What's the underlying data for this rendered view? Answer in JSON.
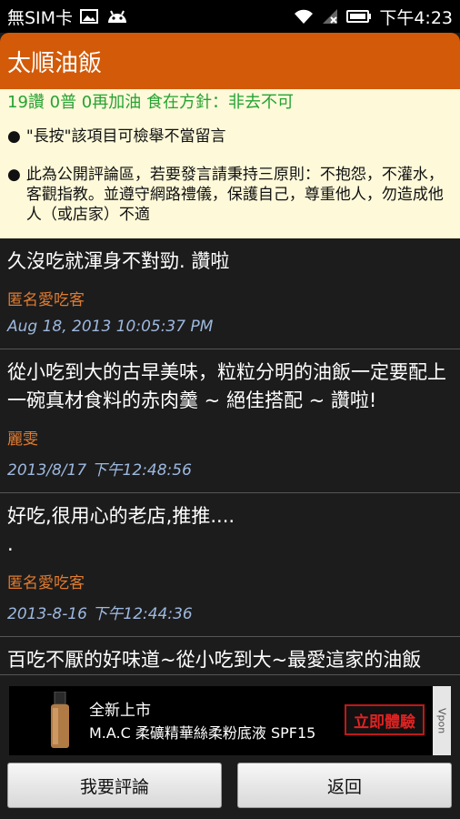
{
  "status_bar": {
    "carrier": "無SIM卡",
    "time": "下午4:23",
    "icons": [
      "image-icon",
      "android-icon",
      "wifi-icon",
      "no-signal-icon",
      "battery-icon"
    ]
  },
  "header": {
    "title": "太順油飯"
  },
  "info": {
    "stats": "19讚 0普 0再加油  食在方針：非去不可",
    "rules": [
      "\"長按\"該項目可檢舉不當留言",
      "此為公開評論區，若要發言請秉持三原則：不抱怨，不灌水，客觀指教。並遵守網路禮儀，保護自己，尊重他人，勿造成他人（或店家）不適"
    ],
    "bullet": "●"
  },
  "comments": [
    {
      "text": "久沒吃就渾身不對勁. 讚啦",
      "author": "匿名愛吃客",
      "time": "Aug 18, 2013 10:05:37 PM"
    },
    {
      "text": "從小吃到大的古早美味，粒粒分明的油飯一定要配上一碗真材食料的赤肉羹 ~ 絕佳搭配 ~ 讚啦!",
      "author": "麗雯",
      "time": "2013/8/17 下午12:48:56"
    },
    {
      "text": "好吃,很用心的老店,推推....\n.",
      "author": "匿名愛吃客",
      "time": "2013-8-16 下午12:44:36"
    },
    {
      "text": "百吃不厭的好味道~從小吃到大~最愛這家的油飯",
      "author": "",
      "time": ""
    }
  ],
  "ad": {
    "line1": "全新上市",
    "line2": "M.A.C 柔礦精華絲柔粉底液 SPF15",
    "cta": "立即體驗",
    "brand": "Vpon"
  },
  "buttons": {
    "comment": "我要評論",
    "back": "返回"
  },
  "colors": {
    "title_bar": "#d35a08",
    "info_bg": "#fdf9d9",
    "stats": "#27a333",
    "author": "#e07b30",
    "timestamp": "#9db8df"
  }
}
